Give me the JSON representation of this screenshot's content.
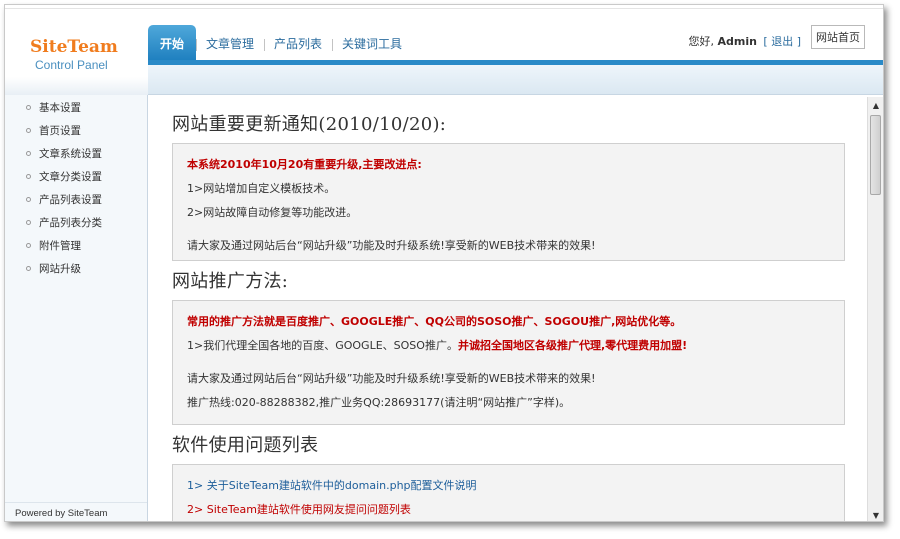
{
  "logo": {
    "title": "SiteTeam",
    "subtitle": "Control Panel"
  },
  "nav": {
    "tabs": [
      {
        "label": "开始",
        "active": true
      },
      {
        "label": "文章管理",
        "active": false
      },
      {
        "label": "产品列表",
        "active": false
      },
      {
        "label": "关键词工具",
        "active": false
      }
    ]
  },
  "user": {
    "greeting_prefix": "您好,",
    "username": "Admin",
    "logout": "[ 退出 ]",
    "site_home": "网站首页"
  },
  "sidebar": {
    "items": [
      {
        "label": "基本设置"
      },
      {
        "label": "首页设置"
      },
      {
        "label": "文章系统设置"
      },
      {
        "label": "文章分类设置"
      },
      {
        "label": "产品列表设置"
      },
      {
        "label": "产品列表分类"
      },
      {
        "label": "附件管理"
      },
      {
        "label": "网站升级"
      }
    ],
    "powered_by": "Powered by SiteTeam"
  },
  "sections": {
    "notice": {
      "title": "网站重要更新通知(2010/10/20):",
      "headline": "本系统2010年10月20有重要升级,主要改进点:",
      "line1": "1>网站增加自定义模板技术。",
      "line2": "2>网站故障自动修复等功能改进。",
      "footer": "请大家及通过网站后台“网站升级”功能及时升级系统!享受新的WEB技术带来的效果!"
    },
    "promo": {
      "title": "网站推广方法:",
      "headline": "常用的推广方法就是百度推广、GOOGLE推广、QQ公司的SOSO推广、SOGOU推广,网站优化等。",
      "line1_plain": "1>我们代理全国各地的百度、GOOGLE、SOSO推广。",
      "line1_red": "并诚招全国地区各级推广代理,零代理费用加盟!",
      "footer": "请大家及通过网站后台“网站升级”功能及时升级系统!享受新的WEB技术带来的效果!",
      "hotline": "推广热线:020-88288382,推广业务QQ:28693177(请注明“网站推广”字样)。"
    },
    "faq": {
      "title": "软件使用问题列表",
      "items": [
        {
          "prefix": "1>",
          "label": "关于SiteTeam建站软件中的domain.php配置文件说明"
        },
        {
          "prefix": "2>",
          "label": "SiteTeam建站软件使用网友提问问题列表"
        }
      ]
    }
  },
  "colors": {
    "accent": "#2a8ac8",
    "brand": "#f07c1e",
    "alert": "#c00000"
  }
}
